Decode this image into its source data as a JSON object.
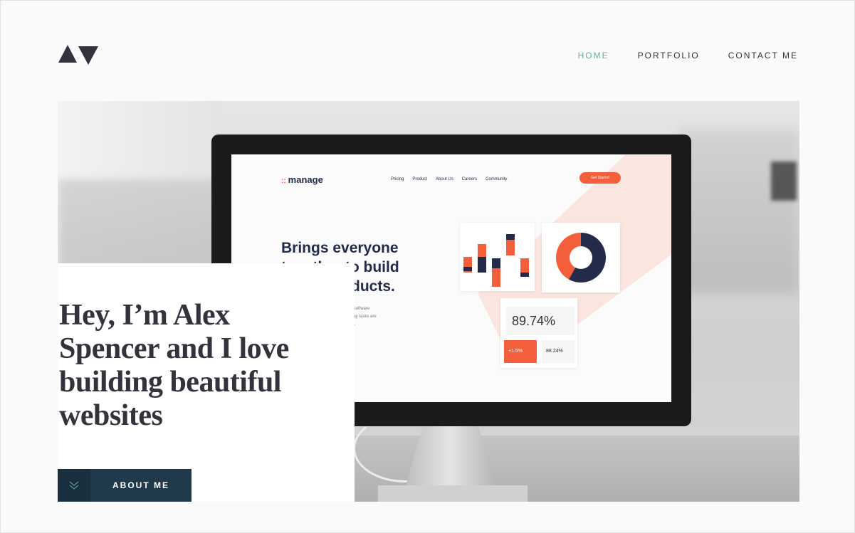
{
  "nav": {
    "items": [
      {
        "label": "HOME",
        "active": true
      },
      {
        "label": "PORTFOLIO",
        "active": false
      },
      {
        "label": "CONTACT ME",
        "active": false
      }
    ],
    "active_color": "#5fb4a2"
  },
  "hero": {
    "image": {
      "screen_logo": "manage",
      "screen_nav": [
        "Pricing",
        "Product",
        "About Us",
        "Careers",
        "Community"
      ],
      "screen_cta": "Get Started",
      "screen_headline": "Brings everyone together to build better products.",
      "screen_sub": "r software\nday tasks are\nol.",
      "stat_main": "89.74%",
      "stat_a": "+1.5%",
      "stat_b": "88.24%"
    },
    "intro_heading": "Hey, I’m Alex Spencer and I love building beautiful websites",
    "cta": {
      "label": "ABOUT ME",
      "icon": "chevrons-down-icon"
    }
  },
  "colors": {
    "primary": "#203a4c",
    "text": "#33323d",
    "accent": "#f25f3a",
    "background": "#fafafa"
  }
}
